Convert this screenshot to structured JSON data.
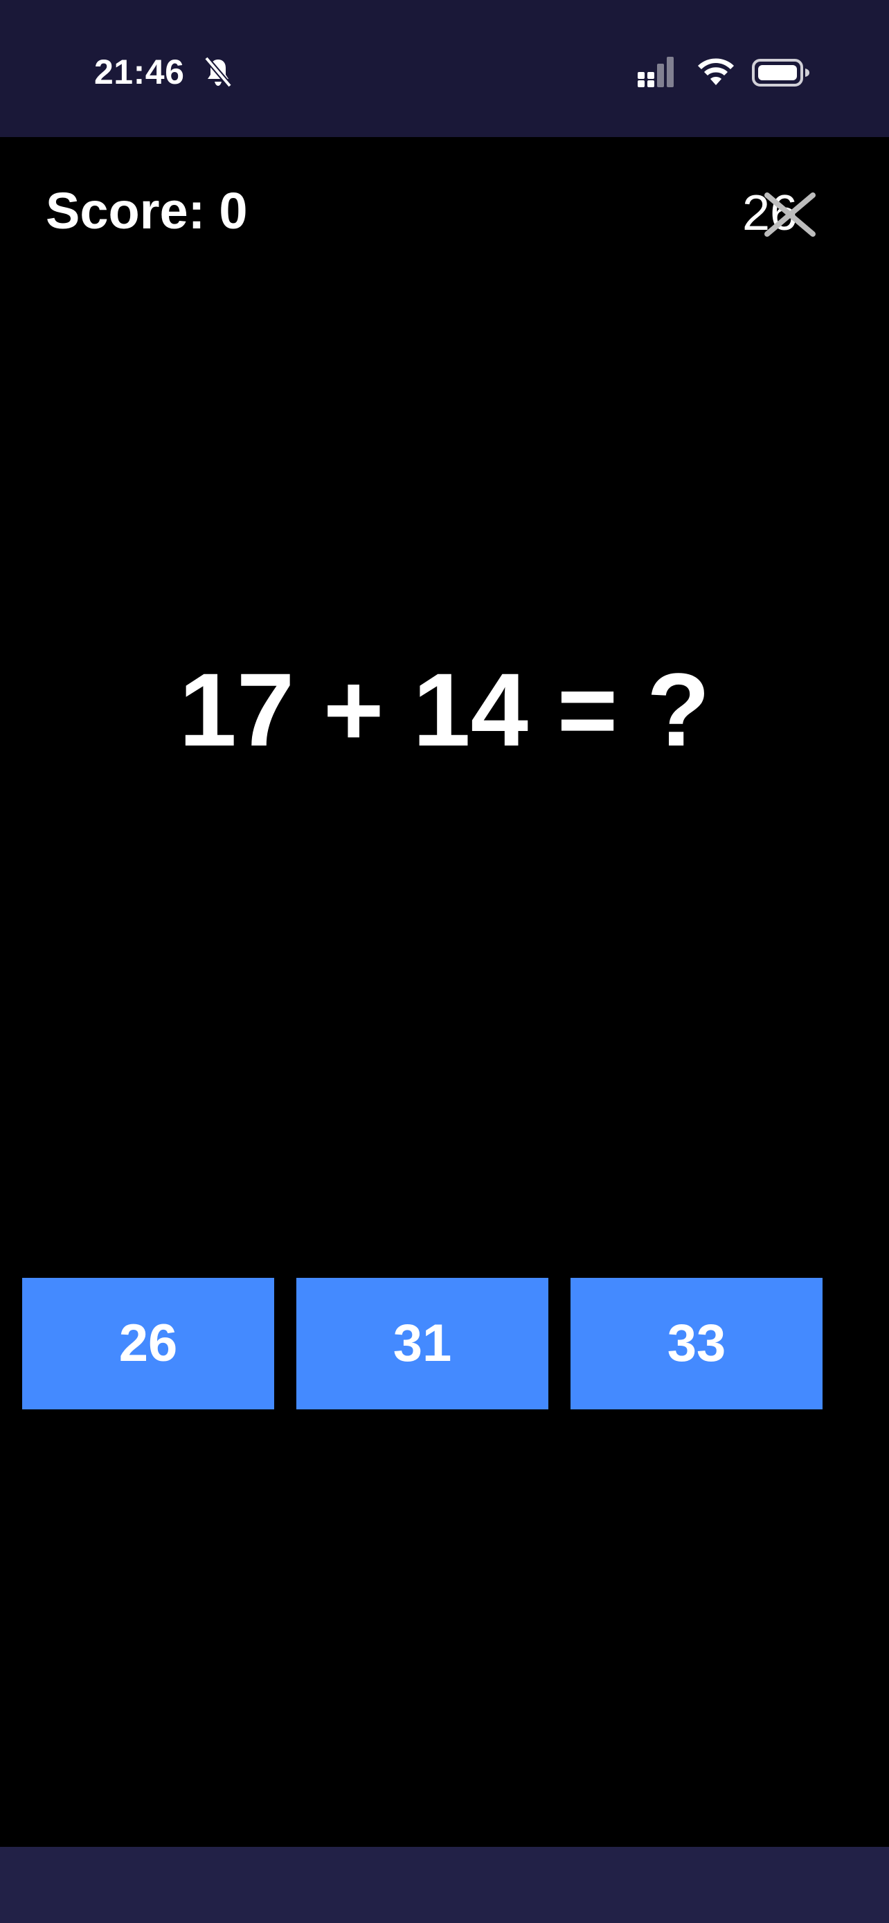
{
  "status_bar": {
    "time": "21:46",
    "background_color": "#1a1838",
    "icons": {
      "silent": "bell-off-icon",
      "signal": "signal-icon",
      "wifi": "wifi-icon",
      "battery": "battery-icon"
    }
  },
  "header": {
    "score_label": "Score:",
    "score_value": "0",
    "timer_text": "26",
    "close_icon": "close-icon"
  },
  "question": {
    "text": "17 + 14 = ?"
  },
  "answers": [
    {
      "label": "26"
    },
    {
      "label": "31"
    },
    {
      "label": "33"
    }
  ],
  "theme": {
    "background": "#000000",
    "answer_button_color": "#448aff",
    "text_color": "#ffffff",
    "bottom_bar_color": "#222147"
  }
}
